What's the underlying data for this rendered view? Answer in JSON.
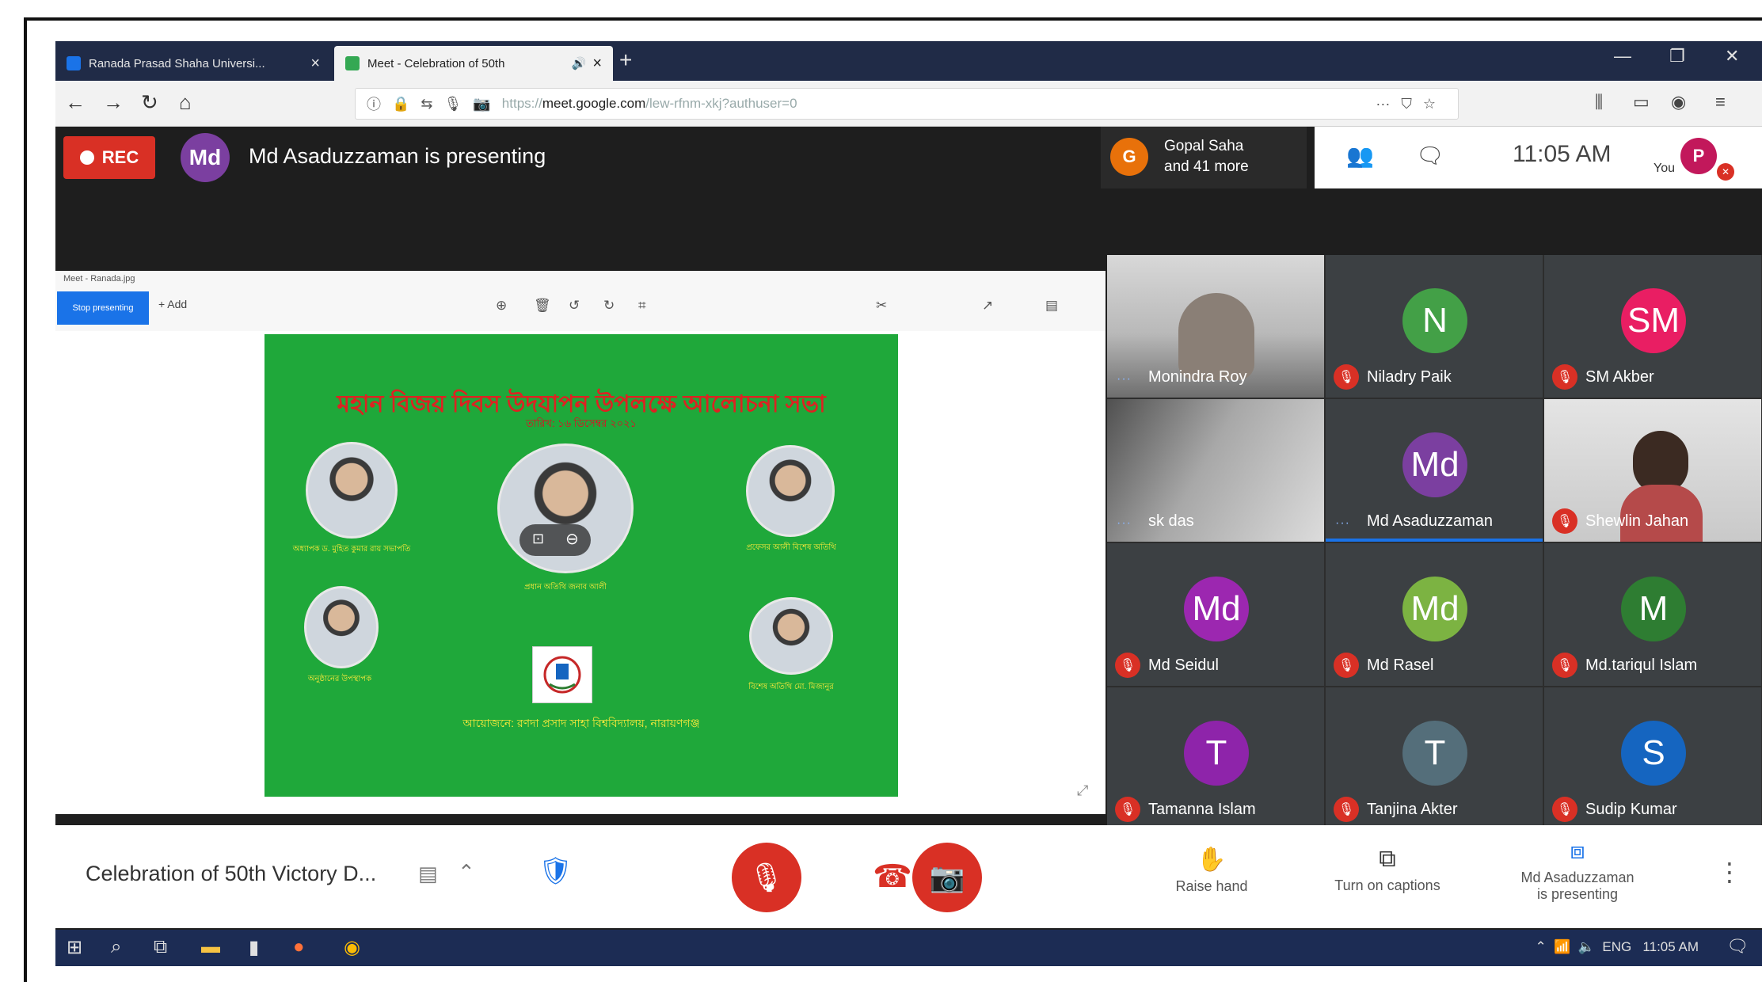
{
  "browser": {
    "tabs": [
      {
        "label": "Ranada Prasad Shaha Universi...",
        "color": "#1a73e8"
      },
      {
        "label": "Meet - Celebration of 50th",
        "color": "#34a853"
      }
    ],
    "url_prefix": "https://",
    "url_domain": "meet.google.com",
    "url_suffix": "/lew-rfnm-xkj?authuser=0"
  },
  "meet": {
    "rec_label": "REC",
    "presenter_initials": "Md",
    "presenting_text": "Md Asaduzzaman is presenting",
    "joined_initial": "G",
    "joined_line1": "Gopal Saha",
    "joined_line2": "and 41 more",
    "time": "11:05 AM",
    "you_label": "You",
    "you_initial": "P"
  },
  "shared": {
    "crumb": "Meet - Ranada.jpg",
    "share_btn": "Stop presenting",
    "add_btn": "+ Add"
  },
  "slide": {
    "title": "মহান বিজয় দিবস উদযাপন উপলক্ষে আলোচনা সভা",
    "subtitle": "তারিখ: ১৬ ডিসেম্বর ২০২১",
    "captions": [
      "অধ্যাপক ড. মুহিত কুমার রায় সভাপতি",
      "প্রধান অতিথি জনাব আলী",
      "প্রফেসর আলী বিশেষ অতিথি",
      "অনুষ্ঠানের উপস্থাপক",
      "বিশেষ অতিথি মো. মিজানুর"
    ],
    "footer": "আয়োজনে: রণদা প্রসাদ সাহা বিশ্ববিদ্যালয়, নারায়ণগঞ্জ"
  },
  "participants": [
    {
      "name": "Monindra Roy",
      "type": "video",
      "status": "dots"
    },
    {
      "name": "Niladry Paik",
      "initials": "N",
      "avatar_color": "#43a047",
      "status": "muted"
    },
    {
      "name": "SM Akber",
      "initials": "SM",
      "avatar_color": "#e91e63",
      "status": "muted"
    },
    {
      "name": "sk das",
      "type": "video",
      "status": "dots"
    },
    {
      "name": "Md Asaduzzaman",
      "initials": "Md",
      "avatar_color": "#7b3fa0",
      "status": "dots",
      "speaking": true
    },
    {
      "name": "Shewlin Jahan",
      "type": "video",
      "status": "muted"
    },
    {
      "name": "Md Seidul",
      "initials": "Md",
      "avatar_color": "#9c27b0",
      "status": "muted"
    },
    {
      "name": "Md Rasel",
      "initials": "Md",
      "avatar_color": "#7cb342",
      "status": "muted"
    },
    {
      "name": "Md.tariqul Islam",
      "initials": "M",
      "avatar_color": "#2e7d32",
      "status": "muted"
    },
    {
      "name": "Tamanna Islam",
      "initials": "T",
      "avatar_color": "#8e24aa",
      "status": "muted"
    },
    {
      "name": "Tanjina Akter",
      "initials": "T",
      "avatar_color": "#546e7a",
      "status": "muted"
    },
    {
      "name": "Sudip Kumar",
      "initials": "S",
      "avatar_color": "#1565c0",
      "status": "muted"
    }
  ],
  "controls": {
    "meeting_name": "Celebration of 50th Victory D...",
    "raise_hand": "Raise hand",
    "captions": "Turn on captions",
    "presenting_line1": "Md Asaduzzaman",
    "presenting_line2": "is presenting"
  },
  "taskbar": {
    "lang": "ENG",
    "time": "11:05 AM"
  },
  "colors": {
    "rec": "#d93025",
    "speaking": "#1a73e8",
    "slide_bg": "#1fa83a"
  }
}
